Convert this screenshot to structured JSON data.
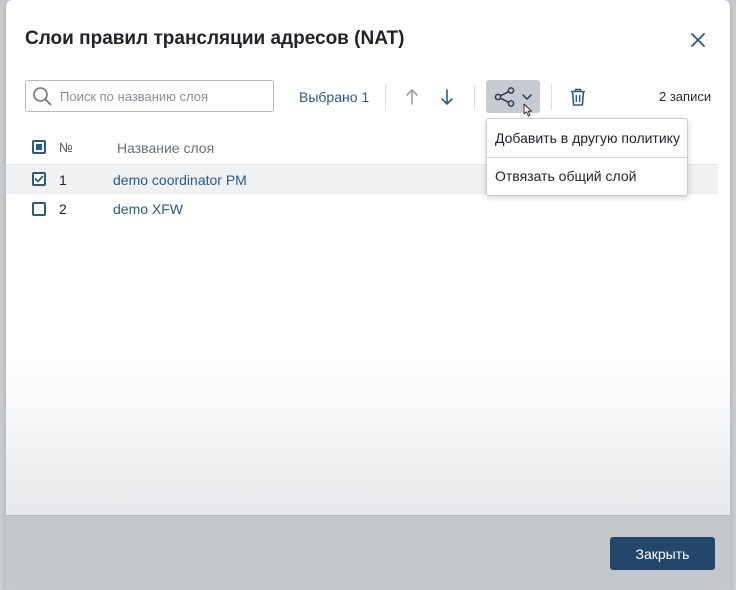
{
  "dialog": {
    "title": "Слои правил трансляции адресов (NAT)"
  },
  "toolbar": {
    "search_placeholder": "Поиск по названию слоя",
    "search_value": "",
    "selected_label": "Выбрано 1",
    "records_label": "2 записи",
    "icons": {
      "search": "search-icon",
      "up": "arrow-up-icon",
      "down": "arrow-down-icon",
      "share": "share-icon",
      "chevron": "chevron-down-icon",
      "delete": "trash-icon",
      "close": "close-icon"
    }
  },
  "table": {
    "columns": [
      "№",
      "Название слоя"
    ],
    "rows": [
      {
        "num": "1",
        "name": "demo coordinator PM",
        "checked": true
      },
      {
        "num": "2",
        "name": "demo XFW",
        "checked": false
      }
    ]
  },
  "share_menu": {
    "items": [
      "Добавить в другую политику",
      "Отвязать общий слой"
    ]
  },
  "footer": {
    "close_label": "Закрыть"
  },
  "colors": {
    "accent": "#2a5a86",
    "primary_button": "#23466b",
    "share_button_bg": "#c5cbd2"
  }
}
